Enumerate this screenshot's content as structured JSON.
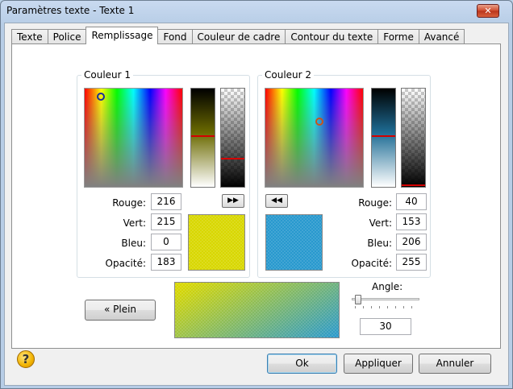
{
  "window": {
    "title": "Paramètres texte - Texte 1",
    "close_label": "✕"
  },
  "tabs": [
    {
      "label": "Texte"
    },
    {
      "label": "Police"
    },
    {
      "label": "Remplissage",
      "active": true
    },
    {
      "label": "Fond"
    },
    {
      "label": "Couleur de cadre"
    },
    {
      "label": "Contour du texte"
    },
    {
      "label": "Forme"
    },
    {
      "label": "Avancé"
    }
  ],
  "color1": {
    "label": "Couleur 1",
    "fields": {
      "rouge_label": "Rouge:",
      "rouge": "216",
      "vert_label": "Vert:",
      "vert": "215",
      "bleu_label": "Bleu:",
      "bleu": "0",
      "opacite_label": "Opacité:",
      "opacite": "183"
    },
    "swatch_color": "#d8d700",
    "copy_button": "▶▶"
  },
  "color2": {
    "label": "Couleur 2",
    "fields": {
      "rouge_label": "Rouge:",
      "rouge": "40",
      "vert_label": "Vert:",
      "vert": "153",
      "bleu_label": "Bleu:",
      "bleu": "206",
      "opacite_label": "Opacité:",
      "opacite": "255"
    },
    "swatch_color": "#2899ce",
    "copy_button": "◀◀"
  },
  "fill_mode_button": "« Plein",
  "angle": {
    "label": "Angle:",
    "value": "30"
  },
  "footer": {
    "ok": "Ok",
    "apply": "Appliquer",
    "cancel": "Annuler",
    "help_glyph": "?"
  }
}
